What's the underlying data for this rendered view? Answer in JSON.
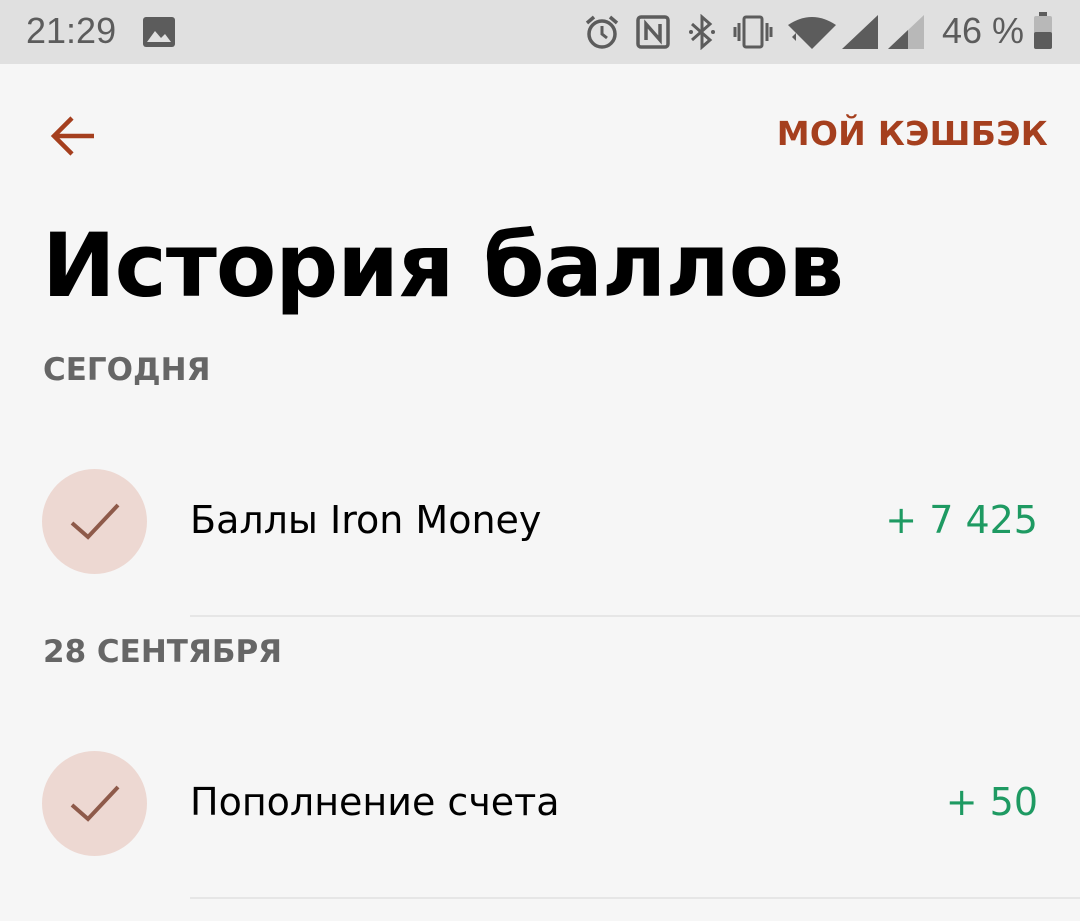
{
  "status_bar": {
    "time": "21:29",
    "battery_text": "46 %",
    "icons": [
      "image-icon",
      "alarm-icon",
      "nfc-icon",
      "bluetooth-icon",
      "vibrate-icon",
      "wifi-icon",
      "signal-icon",
      "signal-weak-icon",
      "battery-icon"
    ]
  },
  "header": {
    "back_icon": "arrow-left-icon",
    "action_label": "МОЙ КЭШБЭК"
  },
  "title": "История баллов",
  "sections": [
    {
      "header": "СЕГОДНЯ",
      "items": [
        {
          "icon": "check-icon",
          "title": "Баллы Iron Money",
          "amount": "+ 7 425"
        }
      ]
    },
    {
      "header": "28 СЕНТЯБРЯ",
      "items": [
        {
          "icon": "check-icon",
          "title": "Пополнение счета",
          "amount": "+ 50"
        }
      ]
    }
  ],
  "colors": {
    "accent": "#a53f1e",
    "positive": "#1e9a62",
    "icon_bg": "#edd8d2",
    "icon_fg": "#8e5a4a",
    "section_text": "#666666"
  }
}
